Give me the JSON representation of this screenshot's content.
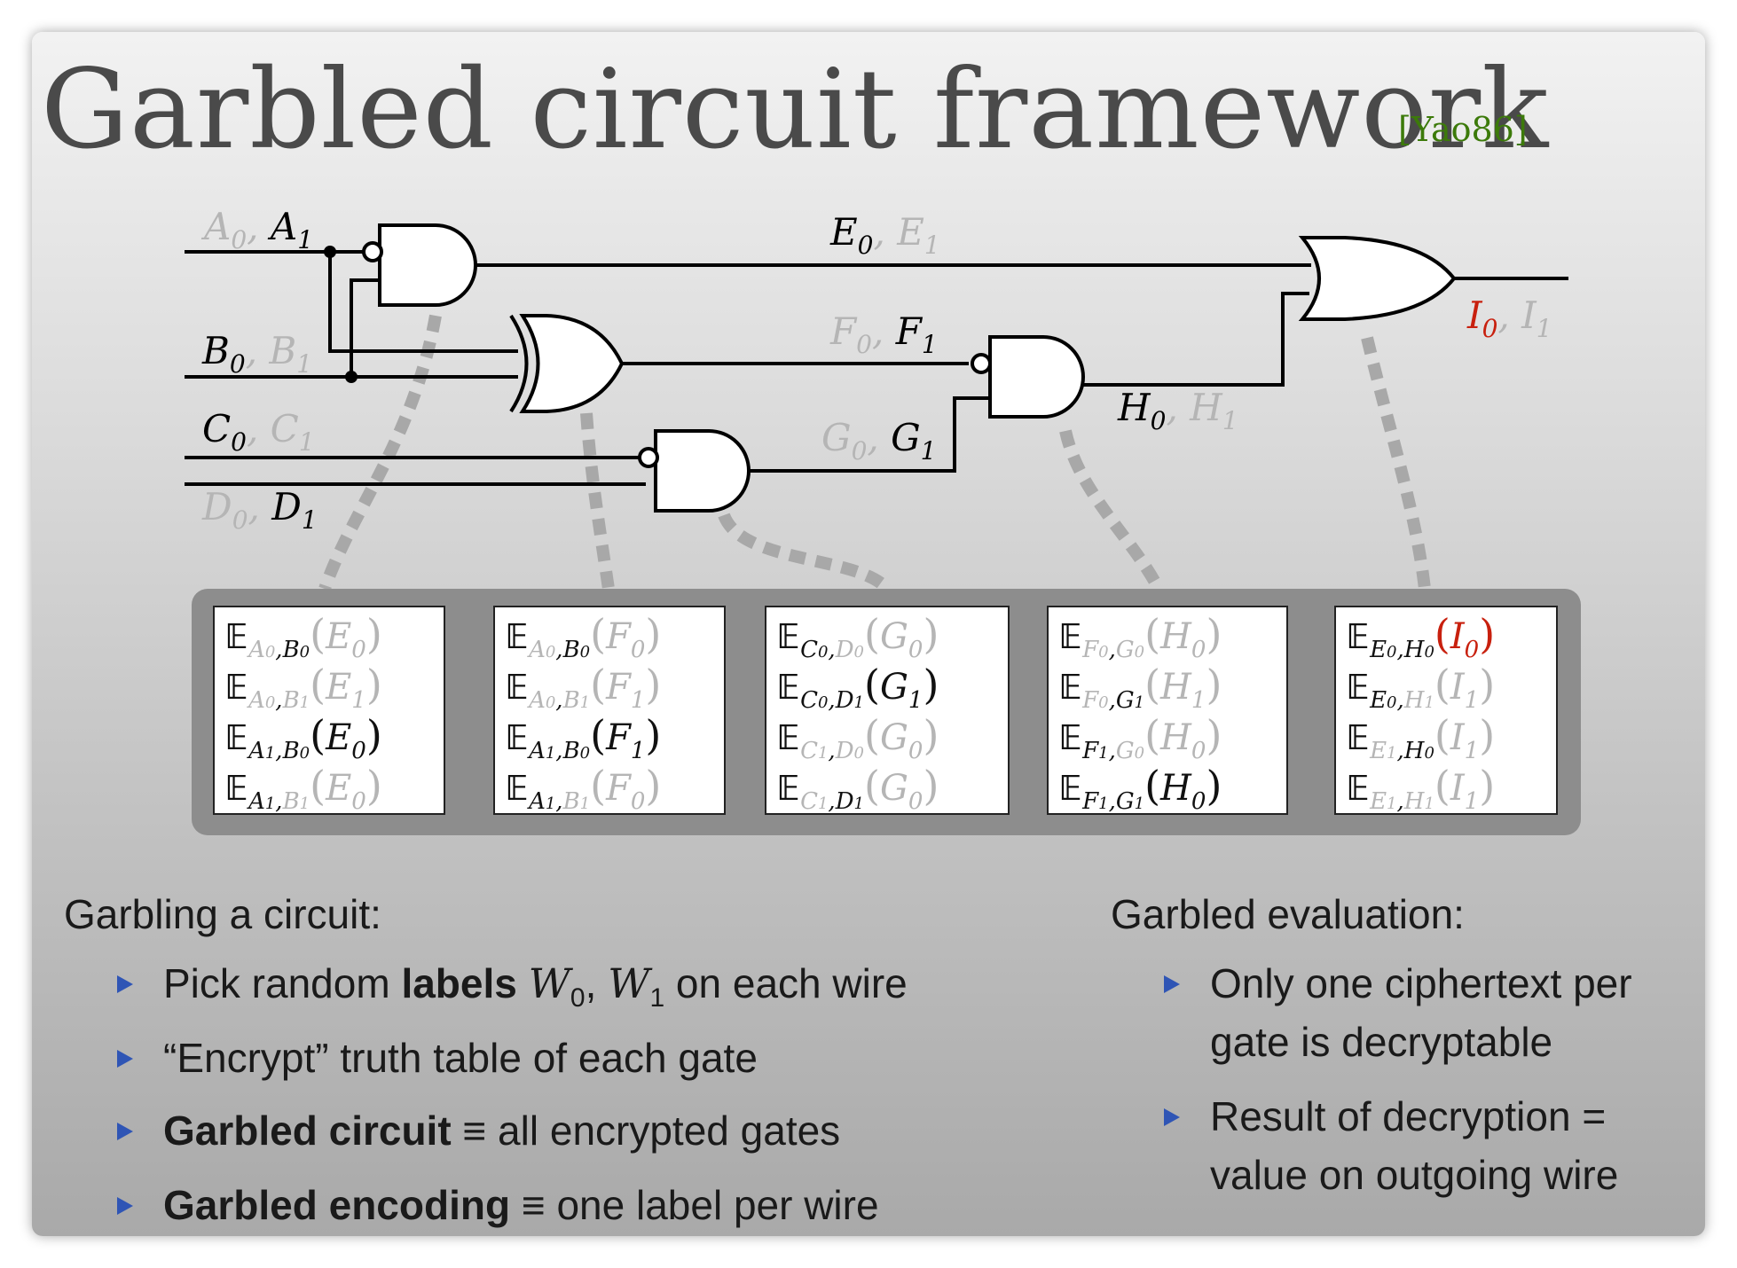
{
  "title": "Garbled circuit framework",
  "citation": "[Yao86]",
  "colors": {
    "title": "#4a4a4a",
    "citation": "#3c7a0a",
    "highlight_red": "#c8200e",
    "inactive_gray": "#b5b5b5",
    "bullet_blue": "#2f55b5",
    "panel": "#8d8d8d"
  },
  "wire_labels": {
    "A": {
      "first": "A",
      "first_sub": "0",
      "second": "A",
      "second_sub": "1",
      "active": "second"
    },
    "B": {
      "first": "B",
      "first_sub": "0",
      "second": "B",
      "second_sub": "1",
      "active": "first"
    },
    "C": {
      "first": "C",
      "first_sub": "0",
      "second": "C",
      "second_sub": "1",
      "active": "first"
    },
    "D": {
      "first": "D",
      "first_sub": "0",
      "second": "D",
      "second_sub": "1",
      "active": "second"
    },
    "E": {
      "first": "E",
      "first_sub": "0",
      "second": "E",
      "second_sub": "1",
      "active": "first"
    },
    "F": {
      "first": "F",
      "first_sub": "0",
      "second": "F",
      "second_sub": "1",
      "active": "second"
    },
    "G": {
      "first": "G",
      "first_sub": "0",
      "second": "G",
      "second_sub": "1",
      "active": "second"
    },
    "H": {
      "first": "H",
      "first_sub": "0",
      "second": "H",
      "second_sub": "1",
      "active": "first"
    },
    "I": {
      "first": "I",
      "first_sub": "0",
      "second": "I",
      "second_sub": "1",
      "active": "first_red"
    }
  },
  "garbled_tables": [
    {
      "gate": "AND-A-B",
      "rows": [
        {
          "k1": "A",
          "k1s": "0",
          "k2": "B",
          "k2s": "0",
          "out": "E",
          "outs": "0",
          "active": false
        },
        {
          "k1": "A",
          "k1s": "0",
          "k2": "B",
          "k2s": "1",
          "out": "E",
          "outs": "1",
          "active": false
        },
        {
          "k1": "A",
          "k1s": "1",
          "k2": "B",
          "k2s": "0",
          "out": "E",
          "outs": "0",
          "active": true
        },
        {
          "k1": "A",
          "k1s": "1",
          "k2": "B",
          "k2s": "1",
          "out": "E",
          "outs": "0",
          "active": false
        }
      ]
    },
    {
      "gate": "XOR-A-B",
      "rows": [
        {
          "k1": "A",
          "k1s": "0",
          "k2": "B",
          "k2s": "0",
          "out": "F",
          "outs": "0",
          "active": false
        },
        {
          "k1": "A",
          "k1s": "0",
          "k2": "B",
          "k2s": "1",
          "out": "F",
          "outs": "1",
          "active": false
        },
        {
          "k1": "A",
          "k1s": "1",
          "k2": "B",
          "k2s": "0",
          "out": "F",
          "outs": "1",
          "active": true
        },
        {
          "k1": "A",
          "k1s": "1",
          "k2": "B",
          "k2s": "1",
          "out": "F",
          "outs": "0",
          "active": false
        }
      ]
    },
    {
      "gate": "AND-C-D",
      "rows": [
        {
          "k1": "C",
          "k1s": "0",
          "k2": "D",
          "k2s": "0",
          "out": "G",
          "outs": "0",
          "active": false
        },
        {
          "k1": "C",
          "k1s": "0",
          "k2": "D",
          "k2s": "1",
          "out": "G",
          "outs": "1",
          "active": true
        },
        {
          "k1": "C",
          "k1s": "1",
          "k2": "D",
          "k2s": "0",
          "out": "G",
          "outs": "0",
          "active": false
        },
        {
          "k1": "C",
          "k1s": "1",
          "k2": "D",
          "k2s": "1",
          "out": "G",
          "outs": "0",
          "active": false
        }
      ]
    },
    {
      "gate": "AND-F-G",
      "rows": [
        {
          "k1": "F",
          "k1s": "0",
          "k2": "G",
          "k2s": "0",
          "out": "H",
          "outs": "0",
          "active": false
        },
        {
          "k1": "F",
          "k1s": "0",
          "k2": "G",
          "k2s": "1",
          "out": "H",
          "outs": "1",
          "active": false
        },
        {
          "k1": "F",
          "k1s": "1",
          "k2": "G",
          "k2s": "0",
          "out": "H",
          "outs": "0",
          "active": false
        },
        {
          "k1": "F",
          "k1s": "1",
          "k2": "G",
          "k2s": "1",
          "out": "H",
          "outs": "0",
          "active": true
        }
      ]
    },
    {
      "gate": "OR-E-H",
      "rows": [
        {
          "k1": "E",
          "k1s": "0",
          "k2": "H",
          "k2s": "0",
          "out": "I",
          "outs": "0",
          "active": true
        },
        {
          "k1": "E",
          "k1s": "0",
          "k2": "H",
          "k2s": "1",
          "out": "I",
          "outs": "1",
          "active": false
        },
        {
          "k1": "E",
          "k1s": "1",
          "k2": "H",
          "k2s": "0",
          "out": "I",
          "outs": "1",
          "active": false
        },
        {
          "k1": "E",
          "k1s": "1",
          "k2": "H",
          "k2s": "1",
          "out": "I",
          "outs": "1",
          "active": false
        }
      ]
    }
  ],
  "table_symbol": "𝔼",
  "garbling": {
    "heading": "Garbling a circuit:",
    "b1_pre": "Pick random ",
    "b1_bold": "labels",
    "b1_var": "W",
    "b1_sub0": "0",
    "b1_sep": ", ",
    "b1_sub1": "1",
    "b1_post": " on each wire",
    "b2": "“Encrypt” truth table of each gate",
    "b3_bold": "Garbled circuit",
    "b3_post": " ≡ all encrypted gates",
    "b4_bold": "Garbled encoding",
    "b4_post": " ≡ one label per wire"
  },
  "evaluation": {
    "heading": "Garbled evaluation:",
    "b1_l1": "Only one ciphertext per",
    "b1_l2": "gate is decryptable",
    "b2_l1": "Result of decryption =",
    "b2_l2": "value on outgoing wire"
  }
}
